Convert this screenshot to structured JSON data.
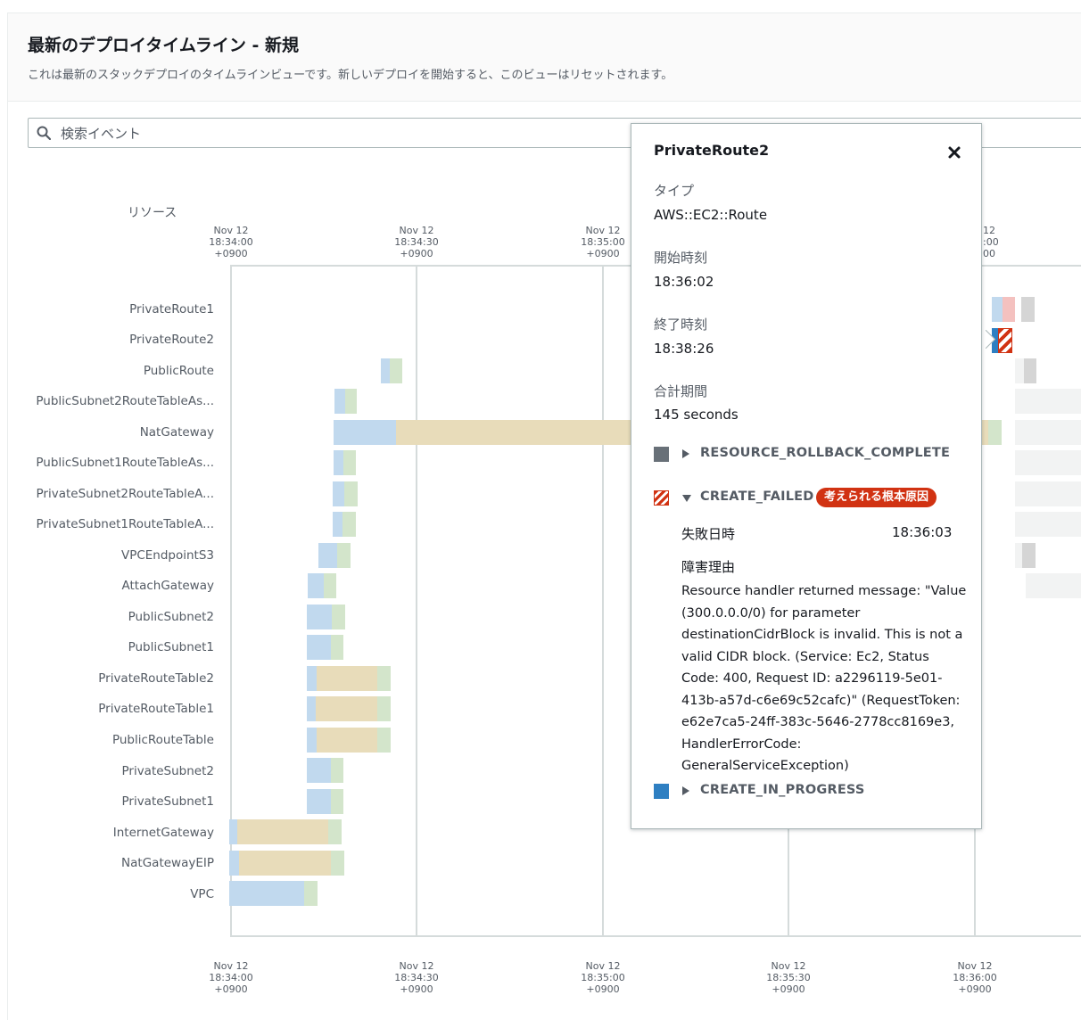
{
  "header": {
    "title": "最新のデプロイタイムライン - 新規",
    "subtitle": "これは最新のスタックデプロイのタイムラインビューです。新しいデプロイを開始すると、このビューはリセットされます。"
  },
  "search": {
    "placeholder": "検索イベント"
  },
  "timeline": {
    "resource_header": "リソース",
    "ticks_top": [
      {
        "date": "Nov 12",
        "time": "18:34:00",
        "tz": "+0900"
      },
      {
        "date": "Nov 12",
        "time": "18:34:30",
        "tz": "+0900"
      },
      {
        "date": "Nov 12",
        "time": "18:35:00",
        "tz": "+0900"
      },
      {
        "date": "12",
        "time": ":00",
        "tz": "00"
      }
    ],
    "ticks_bottom": [
      {
        "date": "Nov 12",
        "time": "18:34:00",
        "tz": "+0900"
      },
      {
        "date": "Nov 12",
        "time": "18:34:30",
        "tz": "+0900"
      },
      {
        "date": "Nov 12",
        "time": "18:35:00",
        "tz": "+0900"
      },
      {
        "date": "Nov 12",
        "time": "18:35:30",
        "tz": "+0900"
      },
      {
        "date": "Nov 12",
        "time": "18:36:00",
        "tz": "+0900"
      }
    ],
    "resources": [
      "PrivateRoute1",
      "PrivateRoute2",
      "PublicRoute",
      "PublicSubnet2RouteTableAs...",
      "NatGateway",
      "PublicSubnet1RouteTableAs...",
      "PrivateSubnet2RouteTableA...",
      "PrivateSubnet1RouteTableA...",
      "VPCEndpointS3",
      "AttachGateway",
      "PublicSubnet2",
      "PublicSubnet1",
      "PrivateRouteTable2",
      "PrivateRouteTable1",
      "PublicRouteTable",
      "PrivateSubnet2",
      "PrivateSubnet1",
      "InternetGateway",
      "NatGatewayEIP",
      "VPC"
    ]
  },
  "popover": {
    "title": "PrivateRoute2",
    "type_label": "タイプ",
    "type_value": "AWS::EC2::Route",
    "start_label": "開始時刻",
    "start_value": "18:36:02",
    "end_label": "終了時刻",
    "end_value": "18:38:26",
    "duration_label": "合計期間",
    "duration_value": "145 seconds",
    "statuses": {
      "rollback": "RESOURCE_ROLLBACK_COMPLETE",
      "failed": "CREATE_FAILED",
      "failed_badge": "考えられる根本原因",
      "in_progress": "CREATE_IN_PROGRESS"
    },
    "failure_time_label": "失敗日時",
    "failure_time_value": "18:36:03",
    "reason_label": "障害理由",
    "reason_text": "Resource handler returned message: \"Value (300.0.0.0/0) for parameter destinationCidrBlock is invalid. This is not a valid CIDR block. (Service: Ec2, Status Code: 400, Request ID: a2296119-5e01-413b-a57d-c6e69c52cafc)\" (RequestToken: e62e7ca5-24ff-383c-5646-2778cc8169e3, HandlerErrorCode: GeneralServiceException)"
  },
  "colors": {
    "in_progress": "#2e7fc2",
    "failed": "#d13212",
    "rollback_complete": "#687078",
    "badge": "#d13212"
  }
}
